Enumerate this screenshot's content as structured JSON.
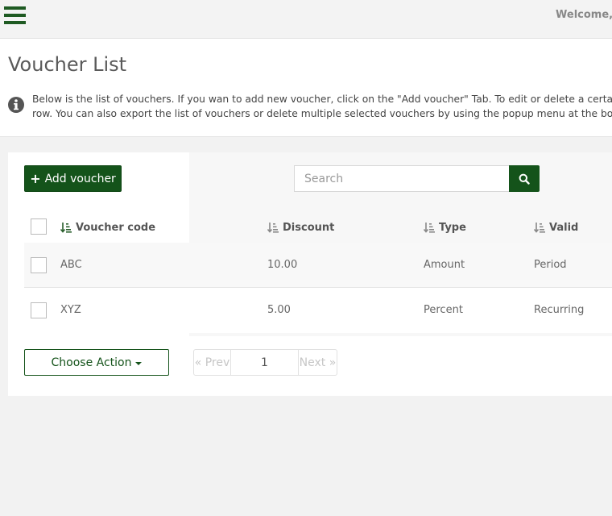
{
  "header": {
    "welcome_text": "Welcome, A"
  },
  "page": {
    "title": "Voucher List",
    "info_line1": "Below is the list of vouchers. If you wan to add new voucher, click on the \"Add voucher\" Tab. To edit or delete a certain vo",
    "info_line2": "row. You can also export the list of vouchers or delete multiple selected vouchers by using the popup menu at the botton"
  },
  "toolbar": {
    "add_label": "Add voucher",
    "search_placeholder": "Search"
  },
  "table": {
    "columns": [
      "Voucher code",
      "Discount",
      "Type",
      "Valid"
    ],
    "rows": [
      {
        "code": "ABC",
        "discount": "10.00",
        "type": "Amount",
        "valid": "Period"
      },
      {
        "code": "XYZ",
        "discount": "5.00",
        "type": "Percent",
        "valid": "Recurring"
      }
    ]
  },
  "footer": {
    "choose_action": "Choose Action",
    "prev": "« Prev",
    "page": "1",
    "next": "Next »"
  },
  "colors": {
    "accent": "#14531a",
    "background": "#f2f2f2"
  }
}
